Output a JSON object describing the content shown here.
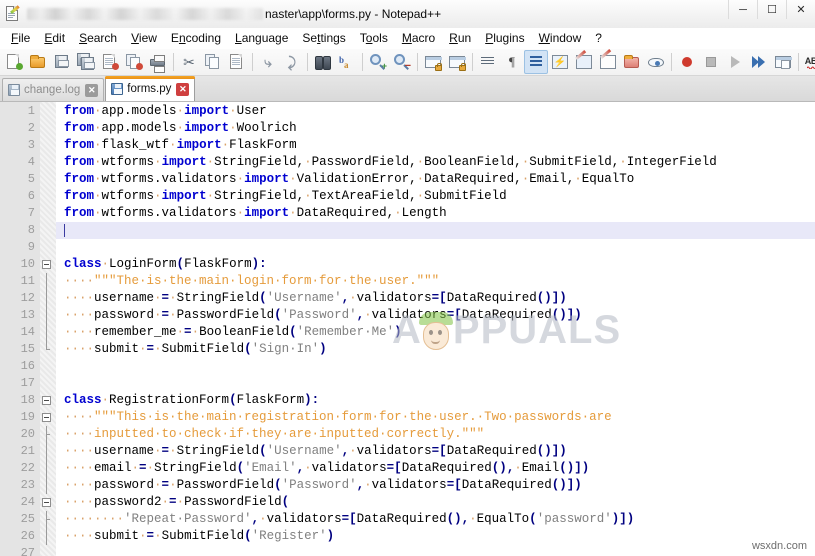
{
  "window": {
    "title_suffix": "naster\\app\\forms.py - Notepad++",
    "title_blurred": true,
    "buttons": [
      {
        "name": "minimize",
        "glyph": "─"
      },
      {
        "name": "maximize",
        "glyph": "☐"
      },
      {
        "name": "close",
        "glyph": "✕"
      }
    ],
    "icon": "notepad-plus-plus-icon"
  },
  "menubar": {
    "items": [
      {
        "label": "File",
        "accel": "F"
      },
      {
        "label": "Edit",
        "accel": "E"
      },
      {
        "label": "Search",
        "accel": "S"
      },
      {
        "label": "View",
        "accel": "V"
      },
      {
        "label": "Encoding",
        "accel": "n"
      },
      {
        "label": "Language",
        "accel": "L"
      },
      {
        "label": "Settings",
        "accel": "t"
      },
      {
        "label": "Tools",
        "accel": "o"
      },
      {
        "label": "Macro",
        "accel": "M"
      },
      {
        "label": "Run",
        "accel": "R"
      },
      {
        "label": "Plugins",
        "accel": "P"
      },
      {
        "label": "Window",
        "accel": "W"
      },
      {
        "label": "?",
        "accel": ""
      }
    ]
  },
  "toolbar": {
    "buttons": [
      "new-file-icon",
      "open-file-icon",
      "save-icon",
      "save-all-icon",
      "close-file-icon",
      "close-all-files-icon",
      "print-icon",
      "cut-icon",
      "copy-icon",
      "paste-icon",
      "undo-icon",
      "redo-icon",
      "find-icon",
      "replace-icon",
      "zoom-in-icon",
      "zoom-out-icon",
      "sync-vertical-scroll-icon",
      "sync-horizontal-scroll-icon",
      "word-wrap-icon",
      "show-all-characters-icon",
      "indent-guideline-icon",
      "user-defined-language-icon",
      "show-document-map-icon",
      "show-function-list-icon",
      "show-folder-as-workspace-icon",
      "monitoring-icon",
      "start-record-macro-icon",
      "stop-record-macro-icon",
      "play-macro-icon",
      "run-macro-multiple-times-icon",
      "save-macro-icon",
      "spell-check-icon"
    ],
    "active_button": "word-wrap-icon",
    "spell_check_label": "ABC"
  },
  "tabs": [
    {
      "label": "change.log",
      "active": false,
      "icon": "saved-file-icon",
      "close_label": "✕"
    },
    {
      "label": "forms.py",
      "active": true,
      "icon": "saved-file-icon",
      "close_label": "✕"
    }
  ],
  "editor": {
    "caret_line": 8,
    "first_line": 1,
    "last_line": 27,
    "line_numbers": [
      1,
      2,
      3,
      4,
      5,
      6,
      7,
      8,
      9,
      10,
      11,
      12,
      13,
      14,
      15,
      16,
      17,
      18,
      19,
      20,
      21,
      22,
      23,
      24,
      25,
      26,
      27
    ],
    "lines": [
      {
        "n": 1,
        "tokens": [
          [
            "kw",
            "from"
          ],
          [
            "dot",
            "·"
          ],
          [
            "ident",
            "app.models"
          ],
          [
            "dot",
            "·"
          ],
          [
            "kw",
            "import"
          ],
          [
            "dot",
            "·"
          ],
          [
            "ident",
            "User"
          ]
        ]
      },
      {
        "n": 2,
        "tokens": [
          [
            "kw",
            "from"
          ],
          [
            "dot",
            "·"
          ],
          [
            "ident",
            "app.models"
          ],
          [
            "dot",
            "·"
          ],
          [
            "kw",
            "import"
          ],
          [
            "dot",
            "·"
          ],
          [
            "ident",
            "Woolrich"
          ]
        ]
      },
      {
        "n": 3,
        "tokens": [
          [
            "kw",
            "from"
          ],
          [
            "dot",
            "·"
          ],
          [
            "ident",
            "flask_wtf"
          ],
          [
            "dot",
            "·"
          ],
          [
            "kw",
            "import"
          ],
          [
            "dot",
            "·"
          ],
          [
            "ident",
            "FlaskForm"
          ]
        ]
      },
      {
        "n": 4,
        "tokens": [
          [
            "kw",
            "from"
          ],
          [
            "dot",
            "·"
          ],
          [
            "ident",
            "wtforms"
          ],
          [
            "dot",
            "·"
          ],
          [
            "kw",
            "import"
          ],
          [
            "dot",
            "·"
          ],
          [
            "ident",
            "StringField,"
          ],
          [
            "dot",
            "·"
          ],
          [
            "ident",
            "PasswordField,"
          ],
          [
            "dot",
            "·"
          ],
          [
            "ident",
            "BooleanField,"
          ],
          [
            "dot",
            "·"
          ],
          [
            "ident",
            "SubmitField,"
          ],
          [
            "dot",
            "·"
          ],
          [
            "ident",
            "IntegerField"
          ]
        ]
      },
      {
        "n": 5,
        "tokens": [
          [
            "kw",
            "from"
          ],
          [
            "dot",
            "·"
          ],
          [
            "ident",
            "wtforms.validators"
          ],
          [
            "dot",
            "·"
          ],
          [
            "kw",
            "import"
          ],
          [
            "dot",
            "·"
          ],
          [
            "ident",
            "ValidationError,"
          ],
          [
            "dot",
            "·"
          ],
          [
            "ident",
            "DataRequired,"
          ],
          [
            "dot",
            "·"
          ],
          [
            "ident",
            "Email,"
          ],
          [
            "dot",
            "·"
          ],
          [
            "ident",
            "EqualTo"
          ]
        ]
      },
      {
        "n": 6,
        "tokens": [
          [
            "kw",
            "from"
          ],
          [
            "dot",
            "·"
          ],
          [
            "ident",
            "wtforms"
          ],
          [
            "dot",
            "·"
          ],
          [
            "kw",
            "import"
          ],
          [
            "dot",
            "·"
          ],
          [
            "ident",
            "StringField,"
          ],
          [
            "dot",
            "·"
          ],
          [
            "ident",
            "TextAreaField,"
          ],
          [
            "dot",
            "·"
          ],
          [
            "ident",
            "SubmitField"
          ]
        ]
      },
      {
        "n": 7,
        "tokens": [
          [
            "kw",
            "from"
          ],
          [
            "dot",
            "·"
          ],
          [
            "ident",
            "wtforms.validators"
          ],
          [
            "dot",
            "·"
          ],
          [
            "kw",
            "import"
          ],
          [
            "dot",
            "·"
          ],
          [
            "ident",
            "DataRequired,"
          ],
          [
            "dot",
            "·"
          ],
          [
            "ident",
            "Length"
          ]
        ]
      },
      {
        "n": 8,
        "tokens": []
      },
      {
        "n": 9,
        "tokens": []
      },
      {
        "n": 10,
        "tokens": [
          [
            "kw",
            "class"
          ],
          [
            "dot",
            "·"
          ],
          [
            "ident",
            "LoginForm"
          ],
          [
            "op",
            "("
          ],
          [
            "ident",
            "FlaskForm"
          ],
          [
            "op",
            ")"
          ],
          [
            "op",
            ":"
          ]
        ]
      },
      {
        "n": 11,
        "tokens": [
          [
            "dot",
            "····"
          ],
          [
            "cmt",
            "\"\"\"The·is·the·main·login·form·for·the·user.\"\"\""
          ]
        ]
      },
      {
        "n": 12,
        "tokens": [
          [
            "dot",
            "····"
          ],
          [
            "ident",
            "username"
          ],
          [
            "dot",
            "·"
          ],
          [
            "op",
            "="
          ],
          [
            "dot",
            "·"
          ],
          [
            "ident",
            "StringField"
          ],
          [
            "op",
            "("
          ],
          [
            "str",
            "'Username'"
          ],
          [
            "op",
            ","
          ],
          [
            "dot",
            "·"
          ],
          [
            "ident",
            "validators"
          ],
          [
            "op",
            "=["
          ],
          [
            "ident",
            "DataRequired"
          ],
          [
            "op",
            "()])"
          ]
        ]
      },
      {
        "n": 13,
        "tokens": [
          [
            "dot",
            "····"
          ],
          [
            "ident",
            "password"
          ],
          [
            "dot",
            "·"
          ],
          [
            "op",
            "="
          ],
          [
            "dot",
            "·"
          ],
          [
            "ident",
            "PasswordField"
          ],
          [
            "op",
            "("
          ],
          [
            "str",
            "'Password'"
          ],
          [
            "op",
            ","
          ],
          [
            "dot",
            "·"
          ],
          [
            "ident",
            "validators"
          ],
          [
            "op",
            "=["
          ],
          [
            "ident",
            "DataRequired"
          ],
          [
            "op",
            "()])"
          ]
        ]
      },
      {
        "n": 14,
        "tokens": [
          [
            "dot",
            "····"
          ],
          [
            "ident",
            "remember_me"
          ],
          [
            "dot",
            "·"
          ],
          [
            "op",
            "="
          ],
          [
            "dot",
            "·"
          ],
          [
            "ident",
            "BooleanField"
          ],
          [
            "op",
            "("
          ],
          [
            "str",
            "'Remember·Me'"
          ],
          [
            "op",
            ")"
          ]
        ]
      },
      {
        "n": 15,
        "tokens": [
          [
            "dot",
            "····"
          ],
          [
            "ident",
            "submit"
          ],
          [
            "dot",
            "·"
          ],
          [
            "op",
            "="
          ],
          [
            "dot",
            "·"
          ],
          [
            "ident",
            "SubmitField"
          ],
          [
            "op",
            "("
          ],
          [
            "str",
            "'Sign·In'"
          ],
          [
            "op",
            ")"
          ]
        ]
      },
      {
        "n": 16,
        "tokens": []
      },
      {
        "n": 17,
        "tokens": []
      },
      {
        "n": 18,
        "tokens": [
          [
            "kw",
            "class"
          ],
          [
            "dot",
            "·"
          ],
          [
            "ident",
            "RegistrationForm"
          ],
          [
            "op",
            "("
          ],
          [
            "ident",
            "FlaskForm"
          ],
          [
            "op",
            ")"
          ],
          [
            "op",
            ":"
          ]
        ]
      },
      {
        "n": 19,
        "tokens": [
          [
            "dot",
            "····"
          ],
          [
            "cmt",
            "\"\"\"This·is·the·main·registration·form·for·the·user.·Two·passwords·are"
          ]
        ]
      },
      {
        "n": 20,
        "tokens": [
          [
            "dot",
            "····"
          ],
          [
            "cmt",
            "inputted·to·check·if·they·are·inputted·correctly.\"\"\""
          ]
        ]
      },
      {
        "n": 21,
        "tokens": [
          [
            "dot",
            "····"
          ],
          [
            "ident",
            "username"
          ],
          [
            "dot",
            "·"
          ],
          [
            "op",
            "="
          ],
          [
            "dot",
            "·"
          ],
          [
            "ident",
            "StringField"
          ],
          [
            "op",
            "("
          ],
          [
            "str",
            "'Username'"
          ],
          [
            "op",
            ","
          ],
          [
            "dot",
            "·"
          ],
          [
            "ident",
            "validators"
          ],
          [
            "op",
            "=["
          ],
          [
            "ident",
            "DataRequired"
          ],
          [
            "op",
            "()])"
          ]
        ]
      },
      {
        "n": 22,
        "tokens": [
          [
            "dot",
            "····"
          ],
          [
            "ident",
            "email"
          ],
          [
            "dot",
            "·"
          ],
          [
            "op",
            "="
          ],
          [
            "dot",
            "·"
          ],
          [
            "ident",
            "StringField"
          ],
          [
            "op",
            "("
          ],
          [
            "str",
            "'Email'"
          ],
          [
            "op",
            ","
          ],
          [
            "dot",
            "·"
          ],
          [
            "ident",
            "validators"
          ],
          [
            "op",
            "=["
          ],
          [
            "ident",
            "DataRequired"
          ],
          [
            "op",
            "(),"
          ],
          [
            "dot",
            "·"
          ],
          [
            "ident",
            "Email"
          ],
          [
            "op",
            "()])"
          ]
        ]
      },
      {
        "n": 23,
        "tokens": [
          [
            "dot",
            "····"
          ],
          [
            "ident",
            "password"
          ],
          [
            "dot",
            "·"
          ],
          [
            "op",
            "="
          ],
          [
            "dot",
            "·"
          ],
          [
            "ident",
            "PasswordField"
          ],
          [
            "op",
            "("
          ],
          [
            "str",
            "'Password'"
          ],
          [
            "op",
            ","
          ],
          [
            "dot",
            "·"
          ],
          [
            "ident",
            "validators"
          ],
          [
            "op",
            "=["
          ],
          [
            "ident",
            "DataRequired"
          ],
          [
            "op",
            "()])"
          ]
        ]
      },
      {
        "n": 24,
        "tokens": [
          [
            "dot",
            "····"
          ],
          [
            "ident",
            "password2"
          ],
          [
            "dot",
            "·"
          ],
          [
            "op",
            "="
          ],
          [
            "dot",
            "·"
          ],
          [
            "ident",
            "PasswordField"
          ],
          [
            "op",
            "("
          ]
        ]
      },
      {
        "n": 25,
        "tokens": [
          [
            "dot",
            "········"
          ],
          [
            "str",
            "'Repeat·Password'"
          ],
          [
            "op",
            ","
          ],
          [
            "dot",
            "·"
          ],
          [
            "ident",
            "validators"
          ],
          [
            "op",
            "=["
          ],
          [
            "ident",
            "DataRequired"
          ],
          [
            "op",
            "(),"
          ],
          [
            "dot",
            "·"
          ],
          [
            "ident",
            "EqualTo"
          ],
          [
            "op",
            "("
          ],
          [
            "str",
            "'password'"
          ],
          [
            "op",
            ")])"
          ]
        ]
      },
      {
        "n": 26,
        "tokens": [
          [
            "dot",
            "····"
          ],
          [
            "ident",
            "submit"
          ],
          [
            "dot",
            "·"
          ],
          [
            "op",
            "="
          ],
          [
            "dot",
            "·"
          ],
          [
            "ident",
            "SubmitField"
          ],
          [
            "op",
            "("
          ],
          [
            "str",
            "'Register'"
          ],
          [
            "op",
            ")"
          ]
        ]
      },
      {
        "n": 27,
        "tokens": []
      }
    ],
    "fold_markers": [
      {
        "line": 10,
        "type": "box"
      },
      {
        "line": 11,
        "type": "line"
      },
      {
        "line": 12,
        "type": "line"
      },
      {
        "line": 13,
        "type": "line"
      },
      {
        "line": 14,
        "type": "line"
      },
      {
        "line": 15,
        "type": "end"
      },
      {
        "line": 18,
        "type": "box"
      },
      {
        "line": 19,
        "type": "box"
      },
      {
        "line": 20,
        "type": "tick"
      },
      {
        "line": 21,
        "type": "line"
      },
      {
        "line": 22,
        "type": "line"
      },
      {
        "line": 23,
        "type": "line"
      },
      {
        "line": 24,
        "type": "box"
      },
      {
        "line": 25,
        "type": "tick"
      },
      {
        "line": 26,
        "type": "line"
      }
    ]
  },
  "watermark": {
    "text": "PPUALS",
    "leading_letter": "A",
    "full": "APPUALS"
  },
  "credit": {
    "text": "wsxdn.com"
  },
  "colors": {
    "keyword": "#0000d0",
    "operator": "#000080",
    "string": "#808080",
    "comment": "#e59b3b",
    "accent_tab": "#f5a623",
    "caret_line": "#e8e8f8"
  }
}
